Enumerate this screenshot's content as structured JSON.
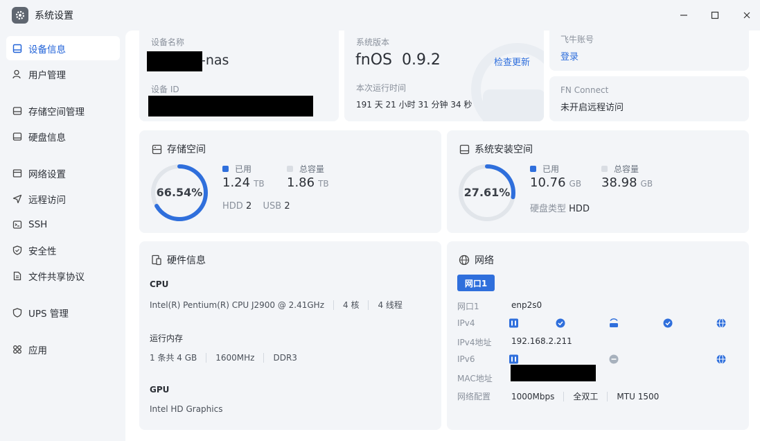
{
  "window": {
    "title": "系统设置",
    "icon": "gear-icon"
  },
  "sidebar": {
    "items": [
      {
        "label": "设备信息",
        "icon": "monitor-icon",
        "active": true
      },
      {
        "label": "用户管理",
        "icon": "user-icon"
      },
      {
        "label": "存储空间管理",
        "icon": "storage-icon"
      },
      {
        "label": "硬盘信息",
        "icon": "disk-icon"
      },
      {
        "label": "网络设置",
        "icon": "network-icon"
      },
      {
        "label": "远程访问",
        "icon": "send-icon"
      },
      {
        "label": "SSH",
        "icon": "terminal-icon"
      },
      {
        "label": "安全性",
        "icon": "shield-check-icon"
      },
      {
        "label": "文件共享协议",
        "icon": "file-icon"
      },
      {
        "label": "UPS 管理",
        "icon": "shield-icon"
      },
      {
        "label": "应用",
        "icon": "apps-icon"
      }
    ]
  },
  "device": {
    "name_label": "设备名称",
    "name_suffix": "-nas",
    "id_label": "设备 ID"
  },
  "system": {
    "version_label": "系统版本",
    "version": "fnOS  0.9.2",
    "check_update": "检查更新",
    "uptime_label": "本次运行时间",
    "uptime": "191 天 21 小时 31 分钟 34 秒"
  },
  "feishu": {
    "label": "飞牛账号",
    "login": "登录"
  },
  "fnconnect": {
    "label": "FN Connect",
    "status": "未开启远程访问"
  },
  "storage": {
    "title": "存储空间",
    "percent": "66.54%",
    "percent_value": 66.54,
    "used_label": "已用",
    "used": "1.24",
    "used_unit": "TB",
    "total_label": "总容量",
    "total": "1.86",
    "total_unit": "TB",
    "hdd_label": "HDD",
    "hdd_count": "2",
    "usb_label": "USB",
    "usb_count": "2"
  },
  "sysinstall": {
    "title": "系统安装空间",
    "percent": "27.61%",
    "percent_value": 27.61,
    "used_label": "已用",
    "used": "10.76",
    "used_unit": "GB",
    "total_label": "总容量",
    "total": "38.98",
    "total_unit": "GB",
    "disk_type_label": "硬盘类型",
    "disk_type": "HDD"
  },
  "hardware": {
    "title": "硬件信息",
    "cpu_label": "CPU",
    "cpu_model": "Intel(R) Pentium(R) CPU J2900 @ 2.41GHz",
    "cpu_cores": "4 核",
    "cpu_threads": "4 线程",
    "mem_label": "运行内存",
    "mem_size": "1 条共 4 GB",
    "mem_freq": "1600MHz",
    "mem_type": "DDR3",
    "gpu_label": "GPU",
    "gpu_model": "Intel HD Graphics"
  },
  "network": {
    "title": "网络",
    "tab": "网口1",
    "port_label": "网口1",
    "port": "enp2s0",
    "ipv4_label": "IPv4",
    "ipv4_addr_label": "IPv4地址",
    "ipv4_addr": "192.168.2.211",
    "ipv6_label": "IPv6",
    "mac_label": "MAC地址",
    "config_label": "网络配置",
    "speed": "1000Mbps",
    "duplex": "全双工",
    "mtu": "MTU 1500"
  },
  "colors": {
    "accent": "#2f6fdc",
    "ring_track": "#e1e5ea",
    "card": "#f3f5f8"
  }
}
